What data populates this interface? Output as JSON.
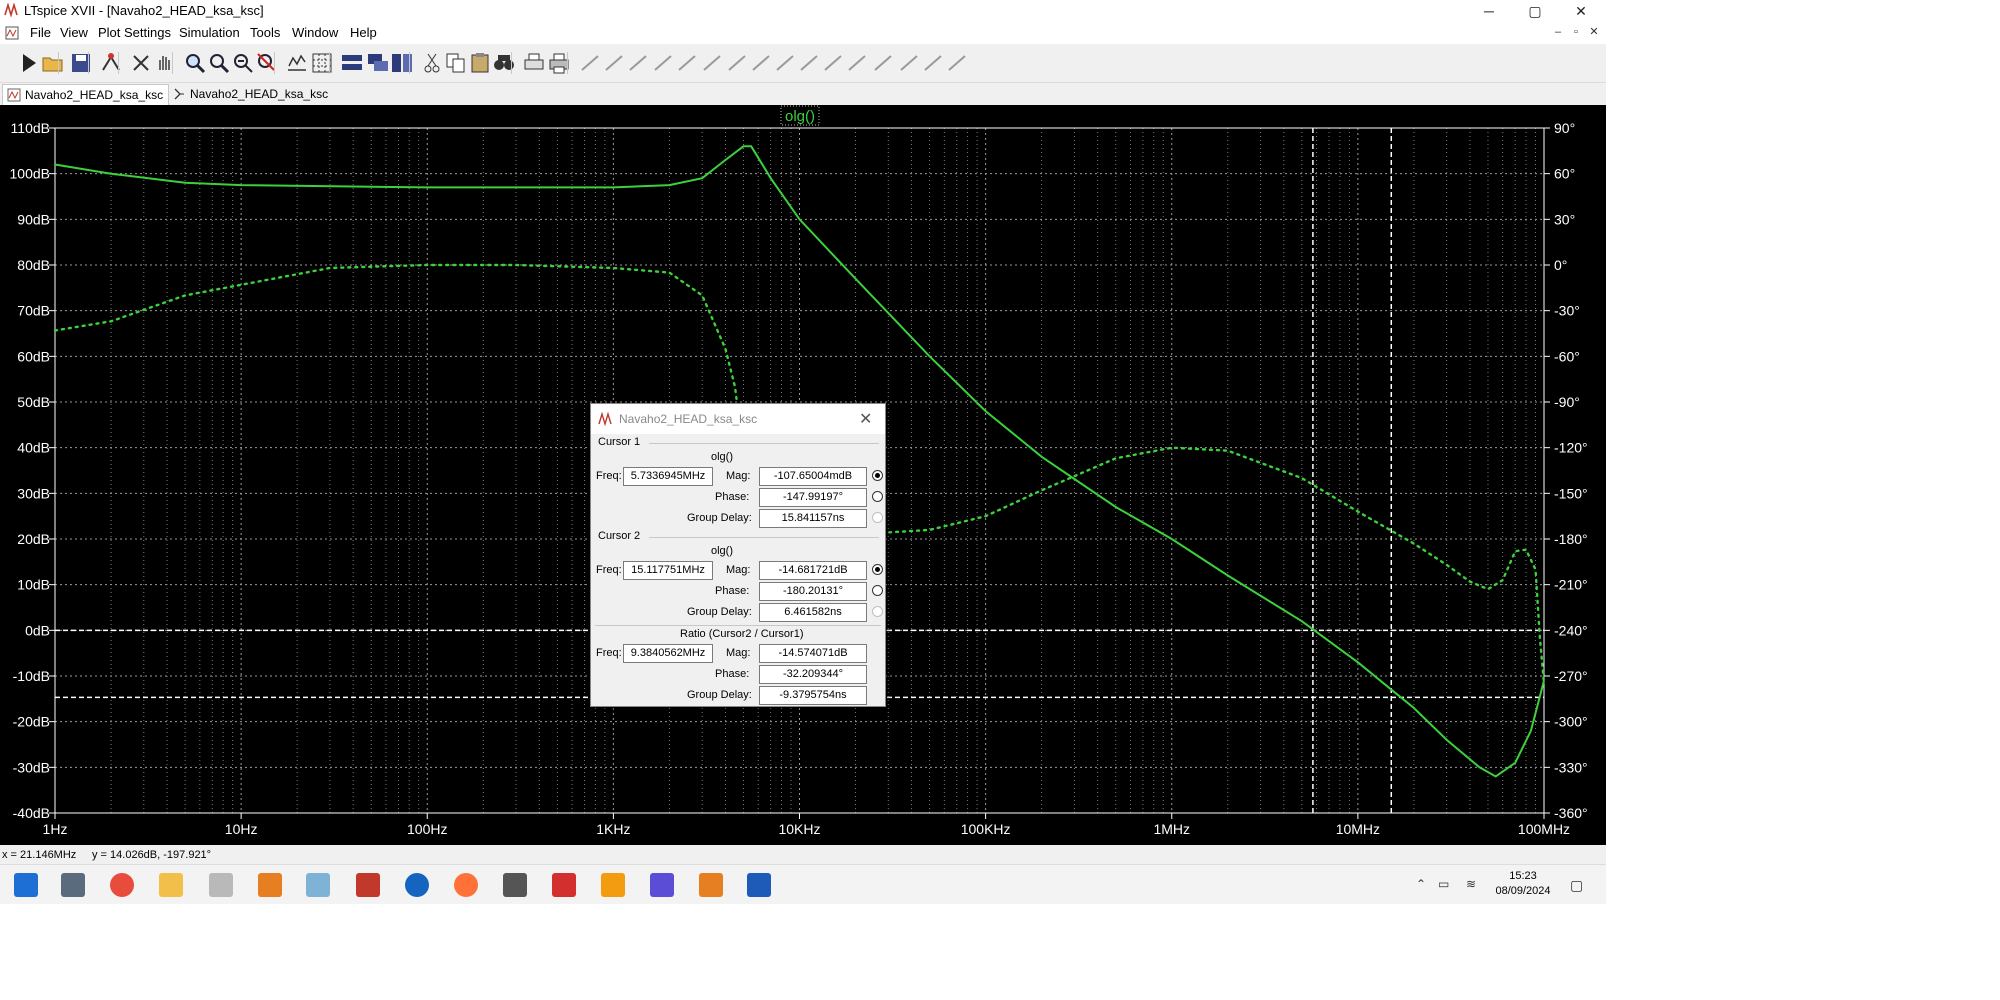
{
  "window": {
    "title": "LTspice XVII - [Navaho2_HEAD_ksa_ksc]",
    "controls": {
      "minimize": "─",
      "maximize": "▢",
      "close": "✕"
    },
    "mdi_controls": {
      "minimize": "–",
      "restore": "▫",
      "close": "✕"
    }
  },
  "menu": [
    "File",
    "View",
    "Plot Settings",
    "Simulation",
    "Tools",
    "Window",
    "Help"
  ],
  "toolbar": [
    "run-icon",
    "open-icon",
    "save-icon",
    "control-panel-icon",
    "halt-icon",
    "pan-icon",
    "zoom-in-icon",
    "zoom-in-alt-icon",
    "zoom-out-icon",
    "zoom-cancel-icon",
    "autorange-icon",
    "mark-grid-icon",
    "tile-horizontal-icon",
    "cascade-icon",
    "tile-vertical-icon",
    "cut-icon",
    "copy-icon",
    "paste-icon",
    "find-icon",
    "print-preview-icon",
    "print-icon",
    "wire-icon",
    "ground-icon",
    "label-icon",
    "resistor-icon",
    "capacitor-icon",
    "inductor-icon",
    "diode-icon",
    "component-icon",
    "move-icon",
    "drag-icon",
    "undo-icon",
    "redo-icon",
    "rotate-icon",
    "mirror-icon",
    "text-icon",
    "spice-directive-icon"
  ],
  "tabs": [
    {
      "label": "Navaho2_HEAD_ksa_ksc",
      "active": true,
      "icon": "waveform-icon"
    },
    {
      "label": "Navaho2_HEAD_ksa_ksc",
      "active": false,
      "icon": "schematic-icon"
    }
  ],
  "plot": {
    "trace_label": "olg()",
    "trace_color": "#3cd03c",
    "cursor_color": "#ffffff",
    "background": "#000000"
  },
  "chart_data": {
    "type": "line",
    "xscale": "log",
    "xlim": [
      1,
      100000000
    ],
    "ylim": [
      -40,
      110
    ],
    "y2lim": [
      -360,
      90
    ],
    "x_ticks": [
      {
        "v": 1,
        "label": "1Hz"
      },
      {
        "v": 10,
        "label": "10Hz"
      },
      {
        "v": 100,
        "label": "100Hz"
      },
      {
        "v": 1000,
        "label": "1KHz"
      },
      {
        "v": 10000,
        "label": "10KHz"
      },
      {
        "v": 100000,
        "label": "100KHz"
      },
      {
        "v": 1000000,
        "label": "1MHz"
      },
      {
        "v": 10000000,
        "label": "10MHz"
      },
      {
        "v": 100000000,
        "label": "100MHz"
      }
    ],
    "y_ticks": [
      {
        "v": 110,
        "label": "110dB"
      },
      {
        "v": 100,
        "label": "100dB"
      },
      {
        "v": 90,
        "label": "90dB"
      },
      {
        "v": 80,
        "label": "80dB"
      },
      {
        "v": 70,
        "label": "70dB"
      },
      {
        "v": 60,
        "label": "60dB"
      },
      {
        "v": 50,
        "label": "50dB"
      },
      {
        "v": 40,
        "label": "40dB"
      },
      {
        "v": 30,
        "label": "30dB"
      },
      {
        "v": 20,
        "label": "20dB"
      },
      {
        "v": 10,
        "label": "10dB"
      },
      {
        "v": 0,
        "label": "0dB"
      },
      {
        "v": -10,
        "label": "-10dB"
      },
      {
        "v": -20,
        "label": "-20dB"
      },
      {
        "v": -30,
        "label": "-30dB"
      },
      {
        "v": -40,
        "label": "-40dB"
      }
    ],
    "y2_ticks": [
      {
        "v": 90,
        "label": "90°"
      },
      {
        "v": 60,
        "label": "60°"
      },
      {
        "v": 30,
        "label": "30°"
      },
      {
        "v": 0,
        "label": "0°"
      },
      {
        "v": -30,
        "label": "-30°"
      },
      {
        "v": -60,
        "label": "-60°"
      },
      {
        "v": -90,
        "label": "-90°"
      },
      {
        "v": -120,
        "label": "-120°"
      },
      {
        "v": -150,
        "label": "-150°"
      },
      {
        "v": -180,
        "label": "-180°"
      },
      {
        "v": -210,
        "label": "-210°"
      },
      {
        "v": -240,
        "label": "-240°"
      },
      {
        "v": -270,
        "label": "-270°"
      },
      {
        "v": -300,
        "label": "-300°"
      },
      {
        "v": -330,
        "label": "-330°"
      },
      {
        "v": -360,
        "label": "-360°"
      }
    ],
    "series": [
      {
        "name": "olg()",
        "kind": "magnitude",
        "axis": "left",
        "style": "solid",
        "x": [
          1,
          2,
          5,
          10,
          100,
          1000,
          2000,
          3000,
          4000,
          5000,
          5500,
          7000,
          10000,
          20000,
          50000,
          100000,
          200000,
          500000,
          1000000,
          2000000,
          5000000,
          10000000,
          20000000,
          30000000,
          45000000,
          55000000,
          70000000,
          85000000,
          100000000
        ],
        "y": [
          102,
          100,
          98,
          97.5,
          97,
          97,
          97.5,
          99,
          103,
          106,
          106,
          99,
          90,
          77,
          60,
          48,
          38,
          27,
          20,
          12,
          2,
          -7,
          -17,
          -24,
          -30,
          -32,
          -29,
          -22,
          -11
        ]
      },
      {
        "axis": "right",
        "kind": "phase",
        "style": "dotted",
        "x": [
          1,
          2,
          5,
          10,
          30,
          100,
          300,
          1000,
          2000,
          3000,
          4000,
          4500,
          5000,
          5500,
          7000,
          10000,
          20000,
          50000,
          100000,
          200000,
          500000,
          1000000,
          2000000,
          5000000,
          10000000,
          20000000,
          30000000,
          40000000,
          50000000,
          60000000,
          70000000,
          80000000,
          90000000,
          95000000,
          100000000
        ],
        "y": [
          -43,
          -37,
          -20,
          -13,
          -2,
          0,
          0,
          -2,
          -5,
          -20,
          -55,
          -80,
          -125,
          -160,
          -179,
          -178,
          -177,
          -174,
          -165,
          -148,
          -127,
          -120,
          -122,
          -140,
          -162,
          -183,
          -197,
          -208,
          -213,
          -207,
          -188,
          -187,
          -200,
          -245,
          -275
        ]
      }
    ],
    "cursors": [
      {
        "x": 5733694.5,
        "y": -147.99197,
        "style": "dashed"
      },
      {
        "x": 15117751,
        "y": -14.681721,
        "style": "dashed"
      }
    ],
    "zero_line": 0
  },
  "cursor_dialog": {
    "title": "Navaho2_HEAD_ksa_ksc",
    "cursor1": {
      "heading": "Cursor 1",
      "trace": "olg()",
      "freq_label": "Freq:",
      "freq": "5.7336945MHz",
      "mag_label": "Mag:",
      "mag": "-107.65004mdB",
      "phase_label": "Phase:",
      "phase": "-147.99197°",
      "gd_label": "Group Delay:",
      "group_delay": "15.841157ns"
    },
    "cursor2": {
      "heading": "Cursor 2",
      "trace": "olg()",
      "freq_label": "Freq:",
      "freq": "15.117751MHz",
      "mag_label": "Mag:",
      "mag": "-14.681721dB",
      "phase_label": "Phase:",
      "phase": "-180.20131°",
      "gd_label": "Group Delay:",
      "group_delay": "6.461582ns"
    },
    "ratio": {
      "heading": "Ratio (Cursor2 / Cursor1)",
      "freq_label": "Freq:",
      "freq": "9.3840562MHz",
      "mag_label": "Mag:",
      "mag": "-14.574071dB",
      "phase_label": "Phase:",
      "phase": "-32.209344°",
      "gd_label": "Group Delay:",
      "group_delay": "-9.3795754ns"
    }
  },
  "status": {
    "x": "x = 21.146MHz",
    "y": "y = 14.026dB, -197.921°"
  },
  "taskbar": {
    "apps": [
      "start-icon",
      "calculator-icon",
      "chrome-icon",
      "file-explorer-icon",
      "app-icon",
      "app2-icon",
      "app3-icon",
      "ltspice-icon",
      "thunderbird-icon",
      "firefox-icon",
      "alien-icon",
      "acrobat-icon",
      "vlc-icon",
      "app4-icon",
      "app5-icon",
      "kicad-icon"
    ],
    "time": "15:23",
    "date": "08/09/2024"
  }
}
